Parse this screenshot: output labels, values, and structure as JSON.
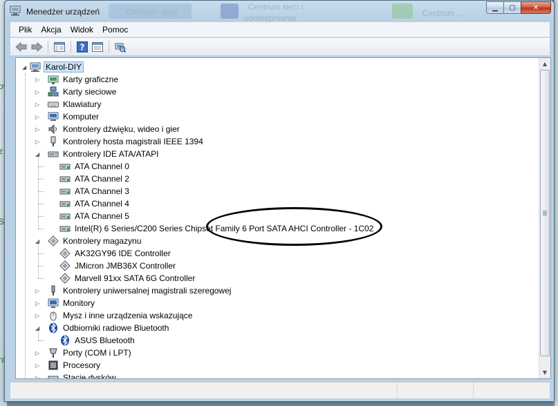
{
  "window": {
    "title": "Menedżer urządzeń"
  },
  "background_windows": {
    "ghost_text_1": "Centrum akcji",
    "ghost_text_2": "Centrum sieci i",
    "ghost_text_3": "Centrum ...",
    "ghost_text_4": "udostępniania"
  },
  "menu": [
    "Plik",
    "Akcja",
    "Widok",
    "Pomoc"
  ],
  "toolbar": {
    "buttons": [
      "back-arrow-icon",
      "forward-arrow-icon",
      "console-tree-icon",
      "help-icon",
      "properties-icon",
      "scan-hardware-icon"
    ]
  },
  "tree": {
    "root": "Karol-DIY",
    "items": [
      {
        "label": "Karty graficzne",
        "level": 1,
        "expanded": false,
        "icon": "display-adapter-icon"
      },
      {
        "label": "Karty sieciowe",
        "level": 1,
        "expanded": false,
        "icon": "network-adapter-icon"
      },
      {
        "label": "Klawiatury",
        "level": 1,
        "expanded": false,
        "icon": "keyboard-icon"
      },
      {
        "label": "Komputer",
        "level": 1,
        "expanded": false,
        "icon": "computer-icon"
      },
      {
        "label": "Kontrolery dźwięku, wideo i gier",
        "level": 1,
        "expanded": false,
        "icon": "sound-icon"
      },
      {
        "label": "Kontrolery hosta magistrali IEEE 1394",
        "level": 1,
        "expanded": false,
        "icon": "firewire-icon"
      },
      {
        "label": "Kontrolery IDE ATA/ATAPI",
        "level": 1,
        "expanded": true,
        "icon": "ide-controller-icon"
      },
      {
        "label": "ATA Channel 0",
        "level": 2,
        "icon": "ide-channel-icon"
      },
      {
        "label": "ATA Channel 2",
        "level": 2,
        "icon": "ide-channel-icon"
      },
      {
        "label": "ATA Channel 3",
        "level": 2,
        "icon": "ide-channel-icon"
      },
      {
        "label": "ATA Channel 4",
        "level": 2,
        "icon": "ide-channel-icon"
      },
      {
        "label": "ATA Channel 5",
        "level": 2,
        "icon": "ide-channel-icon"
      },
      {
        "label": "Intel(R) 6 Series/C200 Series Chipset Family 6 Port SATA AHCI Controller - 1C02",
        "level": 2,
        "icon": "ide-channel-icon"
      },
      {
        "label": "Kontrolery magazynu",
        "level": 1,
        "expanded": true,
        "icon": "storage-controller-icon"
      },
      {
        "label": "AK32GY96 IDE Controller",
        "level": 2,
        "icon": "storage-controller-icon"
      },
      {
        "label": "JMicron JMB36X Controller",
        "level": 2,
        "icon": "storage-controller-icon"
      },
      {
        "label": "Marvell 91xx SATA 6G Controller",
        "level": 2,
        "icon": "storage-controller-icon"
      },
      {
        "label": "Kontrolery uniwersalnej magistrali szeregowej",
        "level": 1,
        "expanded": false,
        "icon": "usb-icon"
      },
      {
        "label": "Monitory",
        "level": 1,
        "expanded": false,
        "icon": "monitor-icon"
      },
      {
        "label": "Mysz i inne urządzenia wskazujące",
        "level": 1,
        "expanded": false,
        "icon": "mouse-icon"
      },
      {
        "label": "Odbiorniki radiowe Bluetooth",
        "level": 1,
        "expanded": true,
        "icon": "bluetooth-icon"
      },
      {
        "label": "ASUS Bluetooth",
        "level": 2,
        "icon": "bluetooth-icon"
      },
      {
        "label": "Porty (COM i LPT)",
        "level": 1,
        "expanded": false,
        "icon": "port-icon"
      },
      {
        "label": "Procesory",
        "level": 1,
        "expanded": false,
        "icon": "processor-icon"
      },
      {
        "label": "Stacje dysków",
        "level": 1,
        "expanded": false,
        "icon": "disk-drive-icon"
      }
    ]
  },
  "colors": {
    "title_bar": "#bcd2e6",
    "selection": "#cfe3f7",
    "annotation": "#000000"
  }
}
